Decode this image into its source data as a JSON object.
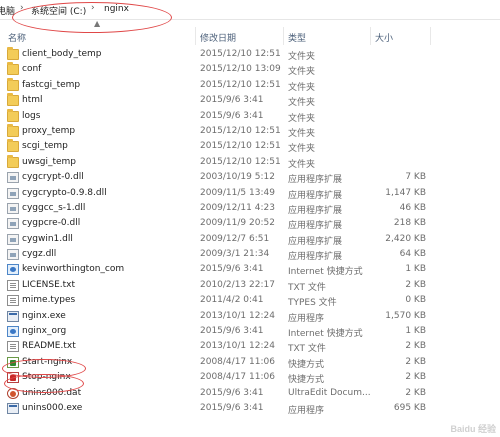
{
  "breadcrumb": {
    "items": [
      "电脑",
      "系统空间 (C:)",
      "nginx"
    ],
    "separator": "›"
  },
  "columns": {
    "name": "名称",
    "modified": "修改日期",
    "type": "类型",
    "size": "大小"
  },
  "files": [
    {
      "name": "client_body_temp",
      "date": "2015/12/10 12:51",
      "type": "文件夹",
      "size": "",
      "icon": "folder-icon"
    },
    {
      "name": "conf",
      "date": "2015/12/10 13:09",
      "type": "文件夹",
      "size": "",
      "icon": "folder-icon"
    },
    {
      "name": "fastcgi_temp",
      "date": "2015/12/10 12:51",
      "type": "文件夹",
      "size": "",
      "icon": "folder-icon"
    },
    {
      "name": "html",
      "date": "2015/9/6 3:41",
      "type": "文件夹",
      "size": "",
      "icon": "folder-icon"
    },
    {
      "name": "logs",
      "date": "2015/9/6 3:41",
      "type": "文件夹",
      "size": "",
      "icon": "folder-icon"
    },
    {
      "name": "proxy_temp",
      "date": "2015/12/10 12:51",
      "type": "文件夹",
      "size": "",
      "icon": "folder-icon"
    },
    {
      "name": "scgi_temp",
      "date": "2015/12/10 12:51",
      "type": "文件夹",
      "size": "",
      "icon": "folder-icon"
    },
    {
      "name": "uwsgi_temp",
      "date": "2015/12/10 12:51",
      "type": "文件夹",
      "size": "",
      "icon": "folder-icon"
    },
    {
      "name": "cygcrypt-0.dll",
      "date": "2003/10/19 5:12",
      "type": "应用程序扩展",
      "size": "7 KB",
      "icon": "dll-icon"
    },
    {
      "name": "cygcrypto-0.9.8.dll",
      "date": "2009/11/5 13:49",
      "type": "应用程序扩展",
      "size": "1,147 KB",
      "icon": "dll-icon"
    },
    {
      "name": "cyggcc_s-1.dll",
      "date": "2009/12/11 4:23",
      "type": "应用程序扩展",
      "size": "46 KB",
      "icon": "dll-icon"
    },
    {
      "name": "cygpcre-0.dll",
      "date": "2009/11/9 20:52",
      "type": "应用程序扩展",
      "size": "218 KB",
      "icon": "dll-icon"
    },
    {
      "name": "cygwin1.dll",
      "date": "2009/12/7 6:51",
      "type": "应用程序扩展",
      "size": "2,420 KB",
      "icon": "dll-icon"
    },
    {
      "name": "cygz.dll",
      "date": "2009/3/1 21:34",
      "type": "应用程序扩展",
      "size": "64 KB",
      "icon": "dll-icon"
    },
    {
      "name": "kevinworthington_com",
      "date": "2015/9/6 3:41",
      "type": "Internet 快捷方式",
      "size": "1 KB",
      "icon": "internet-shortcut-icon"
    },
    {
      "name": "LICENSE.txt",
      "date": "2010/2/13 22:17",
      "type": "TXT 文件",
      "size": "2 KB",
      "icon": "text-file-icon"
    },
    {
      "name": "mime.types",
      "date": "2011/4/2 0:41",
      "type": "TYPES 文件",
      "size": "0 KB",
      "icon": "text-file-icon"
    },
    {
      "name": "nginx.exe",
      "date": "2013/10/1 12:24",
      "type": "应用程序",
      "size": "1,570 KB",
      "icon": "exe-icon"
    },
    {
      "name": "nginx_org",
      "date": "2015/9/6 3:41",
      "type": "Internet 快捷方式",
      "size": "1 KB",
      "icon": "internet-shortcut-icon"
    },
    {
      "name": "README.txt",
      "date": "2013/10/1 12:24",
      "type": "TXT 文件",
      "size": "2 KB",
      "icon": "text-file-icon"
    },
    {
      "name": "Start-nginx",
      "date": "2008/4/17 11:06",
      "type": "快捷方式",
      "size": "2 KB",
      "icon": "start-shortcut-icon"
    },
    {
      "name": "Stop-nginx",
      "date": "2008/4/17 11:06",
      "type": "快捷方式",
      "size": "2 KB",
      "icon": "stop-shortcut-icon"
    },
    {
      "name": "unins000.dat",
      "date": "2015/9/6 3:41",
      "type": "UltraEdit Docum...",
      "size": "2 KB",
      "icon": "dat-file-icon"
    },
    {
      "name": "unins000.exe",
      "date": "2015/9/6 3:41",
      "type": "应用程序",
      "size": "695 KB",
      "icon": "exe-icon"
    }
  ],
  "colors": {
    "annotation": "#e04848",
    "folder": "#f3cc58",
    "header_text": "#4c607a"
  },
  "watermark": "Baidu 经验"
}
